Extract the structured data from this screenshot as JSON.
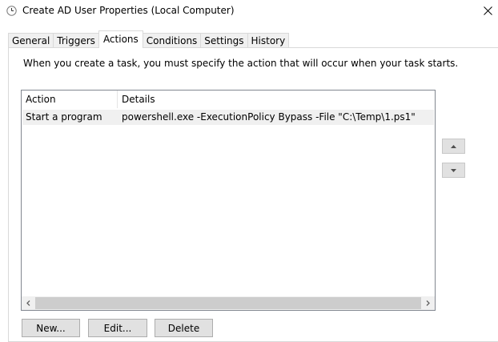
{
  "window": {
    "title": "Create AD User Properties (Local Computer)",
    "icon": "clock-icon",
    "close_icon": "close-icon"
  },
  "tabs": [
    {
      "label": "General",
      "active": false
    },
    {
      "label": "Triggers",
      "active": false
    },
    {
      "label": "Actions",
      "active": true
    },
    {
      "label": "Conditions",
      "active": false
    },
    {
      "label": "Settings",
      "active": false
    },
    {
      "label": "History",
      "active": false
    }
  ],
  "actions_panel": {
    "instruction": "When you create a task, you must specify the action that will occur when your task starts.",
    "columns": [
      "Action",
      "Details"
    ],
    "rows": [
      {
        "action": "Start a program",
        "details": "powershell.exe -ExecutionPolicy Bypass -File \"C:\\Temp\\1.ps1\""
      }
    ],
    "scroll_left_icon": "scroll-left-icon",
    "scroll_right_icon": "scroll-right-icon",
    "move_up_icon": "triangle-up-icon",
    "move_down_icon": "triangle-down-icon"
  },
  "buttons": {
    "new_label": "New...",
    "edit_label": "Edit...",
    "delete_label": "Delete"
  },
  "colors": {
    "selected_row": "#f0f0f0",
    "button_face": "#e1e1e1",
    "border": "#d9d9d9"
  }
}
